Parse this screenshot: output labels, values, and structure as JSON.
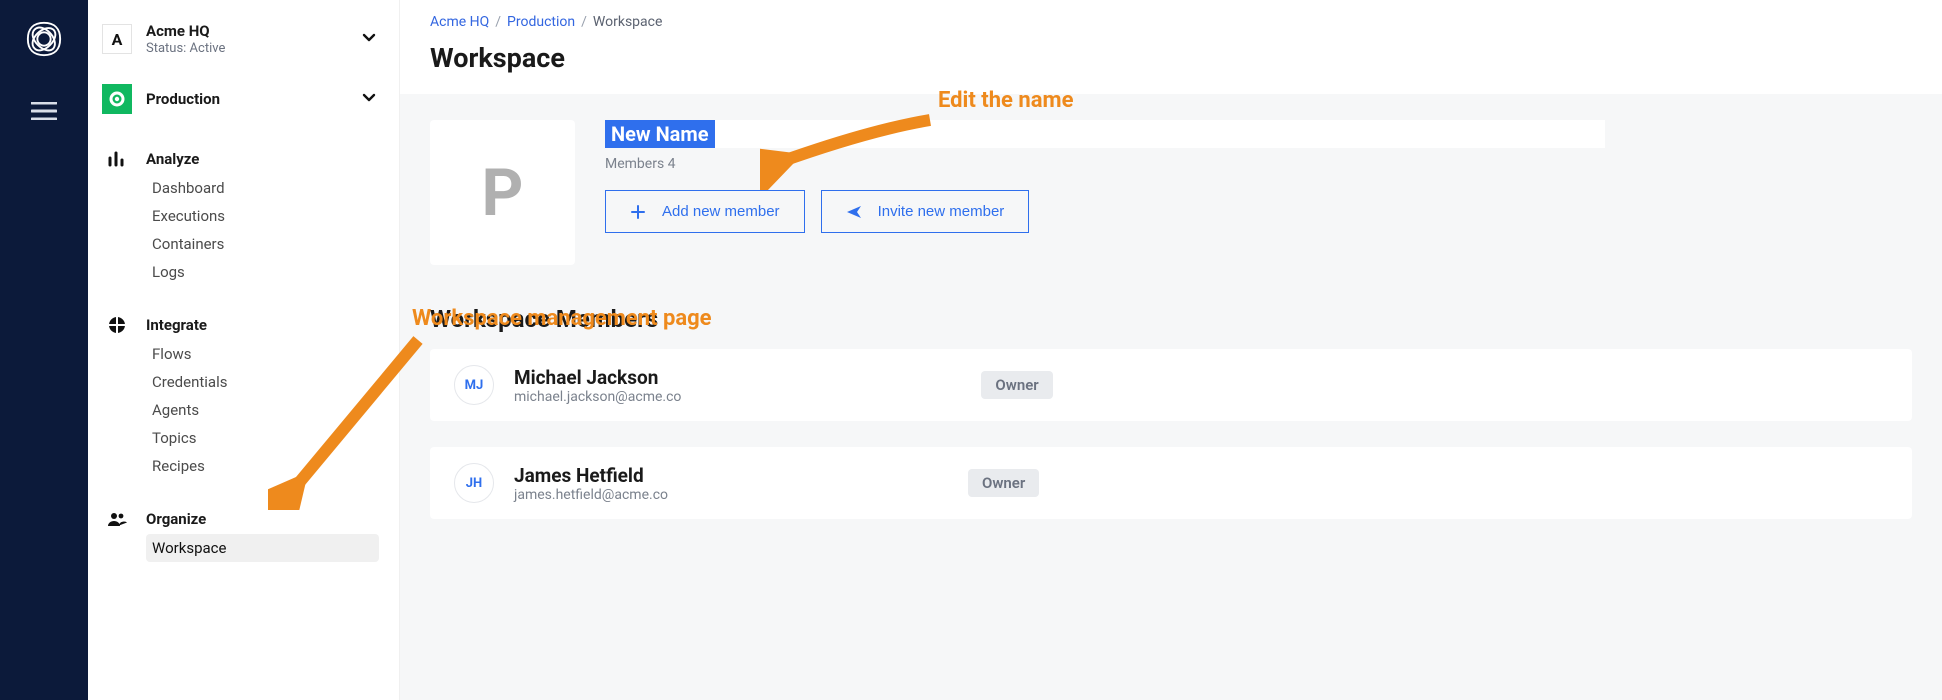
{
  "org": {
    "name": "Acme HQ",
    "letter": "A",
    "status": "Status: Active"
  },
  "project": {
    "name": "Production"
  },
  "breadcrumb": {
    "l1": "Acme HQ",
    "l2": "Production",
    "current": "Workspace"
  },
  "page": {
    "title": "Workspace"
  },
  "nav": {
    "analyze": {
      "label": "Analyze",
      "items": {
        "dashboard": "Dashboard",
        "executions": "Executions",
        "containers": "Containers",
        "logs": "Logs"
      }
    },
    "integrate": {
      "label": "Integrate",
      "items": {
        "flows": "Flows",
        "credentials": "Credentials",
        "agents": "Agents",
        "topics": "Topics",
        "recipes": "Recipes"
      }
    },
    "organize": {
      "label": "Organize",
      "items": {
        "workspace": "Workspace"
      }
    }
  },
  "workspace": {
    "avatar_letter": "P",
    "name_value": "New Name",
    "members_count_label": "Members 4",
    "add_label": "Add new member",
    "invite_label": "Invite new member"
  },
  "members_section_title": "Workspace Members",
  "members": [
    {
      "initials": "MJ",
      "name": "Michael Jackson",
      "email": "michael.jackson@acme.co",
      "role": "Owner"
    },
    {
      "initials": "JH",
      "name": "James Hetfield",
      "email": "james.hetfield@acme.co",
      "role": "Owner"
    }
  ],
  "annotations": {
    "edit_name": "Edit the name",
    "management_page": "Workspace management page"
  }
}
